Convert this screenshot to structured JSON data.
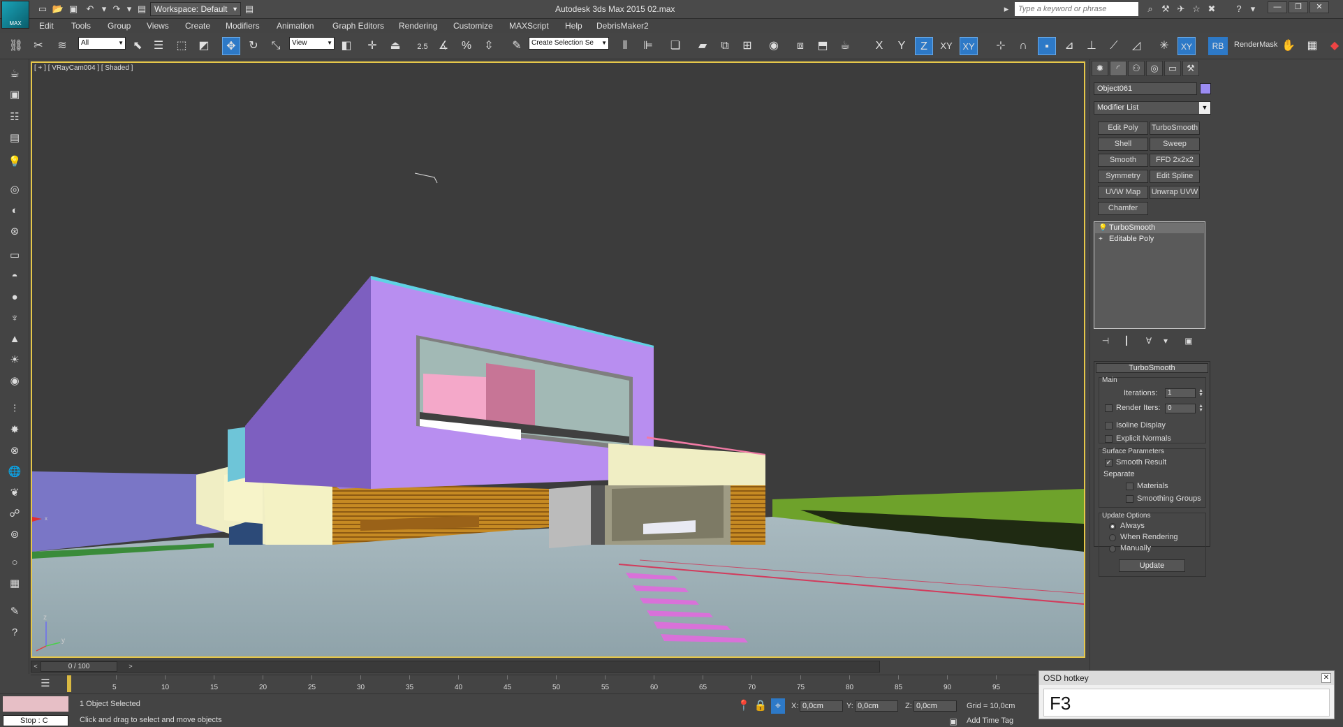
{
  "app": {
    "title": "Autodesk 3ds Max 2015     02.max",
    "logo_text": "MAX",
    "workspace": "Workspace: Default",
    "search_placeholder": "Type a keyword or phrase",
    "window_buttons": [
      "—",
      "❐",
      "✕"
    ]
  },
  "menu": [
    "Edit",
    "Tools",
    "Group",
    "Views",
    "Create",
    "Modifiers",
    "Animation",
    "Graph Editors",
    "Rendering",
    "Customize",
    "MAXScript",
    "Help",
    "DebrisMaker2"
  ],
  "toolbar": {
    "selection_filter": "All",
    "ref_coord": "View",
    "named_selection": "Create Selection Se",
    "snap_angle_label": "2.5",
    "axis_x": "X",
    "axis_y": "Y",
    "axis_z": "Z",
    "axis_xy": "XY",
    "axis_xy2": "XY",
    "render_label": "RenderMask",
    "rb_label": "RB"
  },
  "viewport": {
    "label": "[ + ] [ VRayCam004 ] [ Shaded ]",
    "axis_z": "z",
    "axis_y": "y",
    "axis_x": "x"
  },
  "command_panel": {
    "object_name": "Object061",
    "object_color": "#9b8cf2",
    "modifier_list": "Modifier List",
    "modifier_buttons": [
      "Edit Poly",
      "TurboSmooth",
      "Shell",
      "Sweep",
      "Smooth",
      "FFD 2x2x2",
      "Symmetry",
      "Edit Spline",
      "UVW Map",
      "Unwrap UVW",
      "Chamfer"
    ],
    "stack": [
      "TurboSmooth",
      "Editable Poly"
    ],
    "rollout_title": "TurboSmooth",
    "main_group": "Main",
    "iterations_label": "Iterations:",
    "iterations_value": "1",
    "render_iters_label": "Render Iters:",
    "render_iters_value": "0",
    "isoline_label": "Isoline Display",
    "explicit_normals_label": "Explicit Normals",
    "surface_group": "Surface Parameters",
    "smooth_result_label": "Smooth Result",
    "separate_label": "Separate",
    "materials_label": "Materials",
    "smoothing_groups_label": "Smoothing Groups",
    "update_group": "Update Options",
    "always_label": "Always",
    "when_rendering_label": "When Rendering",
    "manually_label": "Manually",
    "update_button": "Update"
  },
  "timeline": {
    "frame_display": "0 / 100",
    "ticks": [
      "5",
      "10",
      "15",
      "20",
      "25",
      "30",
      "35",
      "40",
      "45",
      "50",
      "55",
      "60",
      "65",
      "70",
      "75",
      "80",
      "85",
      "90",
      "95"
    ]
  },
  "status": {
    "selection": "1 Object Selected",
    "prompt": "Click and drag to select and move objects",
    "stop_label": "Stop  : C",
    "x_label": "X:",
    "x_value": "0,0cm",
    "y_label": "Y:",
    "y_value": "0,0cm",
    "z_label": "Z:",
    "z_value": "0,0cm",
    "grid": "Grid = 10,0cm",
    "add_time_tag": "Add Time Tag"
  },
  "osd": {
    "title": "OSD hotkey",
    "key": "F3"
  }
}
